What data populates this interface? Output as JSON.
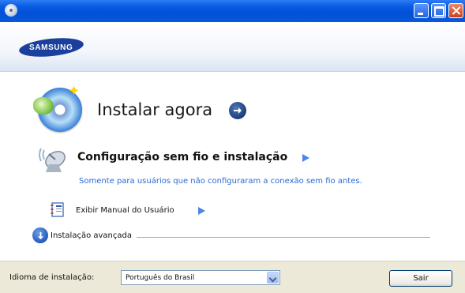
{
  "window": {
    "icon": "app-disc-icon",
    "controls": [
      "minimize",
      "maximize",
      "close"
    ]
  },
  "header": {
    "brand": "SAMSUNG"
  },
  "main": {
    "install_now": "Instalar agora",
    "wireless": {
      "title": "Configuração sem fio e instalação",
      "subtitle": "Somente para usuários que não configuraram a conexão sem fio antes."
    },
    "manual": {
      "label": "Exibir Manual do Usuário"
    },
    "advanced": {
      "label": "Instalação avançada"
    }
  },
  "footer": {
    "language_label": "Idioma de instalação:",
    "language_value": "Português do Brasil",
    "exit_label": "Sair"
  },
  "colors": {
    "titlebar": "#0a5be0",
    "accent_link": "#2b6bd6",
    "arrow_blue": "#4a86e8",
    "brand_blue": "#1a3f9c"
  }
}
